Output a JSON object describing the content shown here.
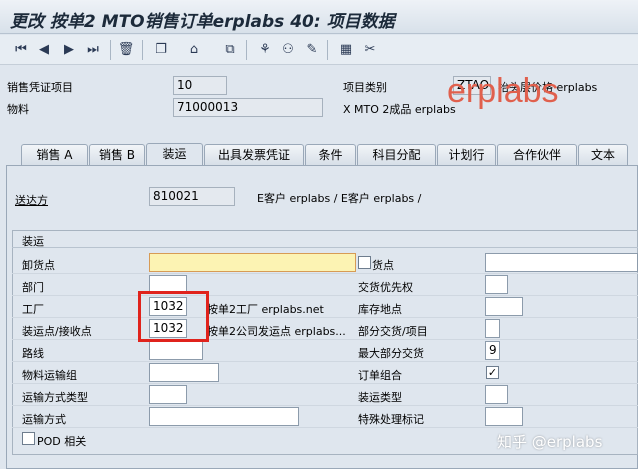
{
  "window": {
    "title": "更改 按单2 MTO销售订单erplabs 40: 项目数据"
  },
  "toolbar": {
    "icons": [
      "first-page-icon",
      "previous-page-icon",
      "next-page-icon",
      "last-page-icon",
      "delete-icon",
      "copy-icon",
      "home-icon",
      "display-icon",
      "hierarchy-icon",
      "partner-icon",
      "edit-icon",
      "calculator-icon",
      "tools-icon"
    ]
  },
  "header": {
    "sales_doc_item_label": "销售凭证项目",
    "sales_doc_item_value": "10",
    "item_category_label": "项目类别",
    "item_category_value": "ZTAO",
    "item_category_desc": "抬头层价格 erplabs",
    "material_label": "物料",
    "material_value": "71000013",
    "material_desc": "X MTO 2成品 erplabs"
  },
  "watermark": "erplabs",
  "tabs": [
    "销售 A",
    "销售 B",
    "装运",
    "出具发票凭证",
    "条件",
    "科目分配",
    "计划行",
    "合作伙伴",
    "文本"
  ],
  "ship_to": {
    "label": "送达方",
    "value": "810021",
    "desc": "E客户 erplabs / E客户 erplabs /"
  },
  "shipping": {
    "group_title": "装运",
    "unloading_point_label": "卸货点",
    "unloading_point_value": "",
    "receiving_point_label": "货点",
    "receiving_point_value": "",
    "department_label": "部门",
    "department_value": "",
    "delivery_priority_label": "交货优先权",
    "delivery_priority_value": "",
    "plant_label": "工厂",
    "plant_value": "1032",
    "plant_desc": "按单2工厂 erplabs.net",
    "storage_location_label": "库存地点",
    "storage_location_value": "",
    "shipping_point_label": "装运点/接收点",
    "shipping_point_value": "1032",
    "shipping_point_desc": "按单2公司发运点 erplabs...",
    "partial_delivery_label": "部分交货/项目",
    "partial_delivery_value": "",
    "route_label": "路线",
    "route_value": "",
    "max_partial_label": "最大部分交货",
    "max_partial_value": "9",
    "mat_freight_group_label": "物料运输组",
    "mat_freight_group_value": "",
    "order_combination_label": "订单组合",
    "order_combination_checked": "✓",
    "transport_type_label": "运输方式类型",
    "transport_type_value": "",
    "shipping_type_label": "装运类型",
    "shipping_type_value": "",
    "transport_mode_label": "运输方式",
    "transport_mode_value": "",
    "special_processing_label": "特殊处理标记",
    "special_processing_value": "",
    "pod_label": "POD 相关"
  },
  "footer_watermark": "知乎 @erplabs"
}
